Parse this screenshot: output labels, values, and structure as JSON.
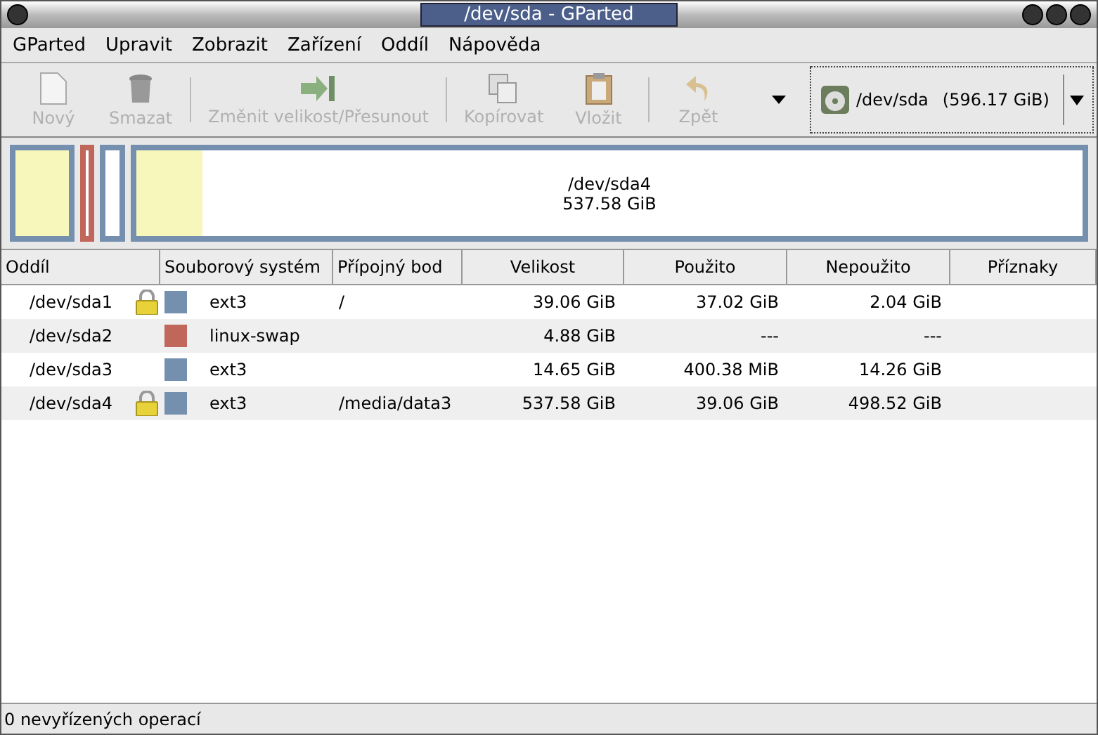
{
  "window": {
    "title": "/dev/sda - GParted"
  },
  "menu": [
    "GParted",
    "Upravit",
    "Zobrazit",
    "Zařízení",
    "Oddíl",
    "Nápověda"
  ],
  "toolbar": [
    {
      "kind": "new",
      "label": "Nový",
      "disabled": true
    },
    {
      "kind": "delete",
      "label": "Smazat",
      "disabled": true
    },
    {
      "kind": "separator"
    },
    {
      "kind": "resize",
      "label": "Změnit velikost/Přesunout",
      "disabled": true
    },
    {
      "kind": "separator"
    },
    {
      "kind": "copy",
      "label": "Kopírovat",
      "disabled": true
    },
    {
      "kind": "paste",
      "label": "Vložit",
      "disabled": true
    },
    {
      "kind": "separator"
    },
    {
      "kind": "undo",
      "label": "Zpět",
      "disabled": true
    }
  ],
  "device": {
    "name": "/dev/sda",
    "size": "(596.17 GiB)"
  },
  "map": [
    {
      "kind": "medium",
      "color": "#7590ae",
      "level": 1
    },
    {
      "kind": "tiny",
      "color": "#c1665a"
    },
    {
      "kind": "small",
      "color": "#7590ae"
    },
    {
      "kind": "large",
      "color": "#7590ae",
      "level": 0.07,
      "name": "/dev/sda4",
      "size": "537.58 GiB"
    }
  ],
  "table": {
    "columns": [
      "Oddíl",
      "Souborový systém",
      "Přípojný bod",
      "Velikost",
      "Použito",
      "Nepoužito",
      "Příznaky"
    ],
    "rows": [
      {
        "partition": "/dev/sda1",
        "locked": true,
        "color": "#7590ae",
        "fs": "ext3",
        "mount": "/",
        "size": "39.06 GiB",
        "used": "37.02 GiB",
        "unused": "2.04 GiB"
      },
      {
        "partition": "/dev/sda2",
        "locked": false,
        "color": "#c1665a",
        "fs": "linux-swap",
        "size": "4.88 GiB",
        "used": "---",
        "unused": "---"
      },
      {
        "partition": "/dev/sda3",
        "locked": false,
        "color": "#7590ae",
        "fs": "ext3",
        "size": "14.65 GiB",
        "used": "400.38 MiB",
        "unused": "14.26 GiB"
      },
      {
        "partition": "/dev/sda4",
        "locked": true,
        "color": "#7590ae",
        "fs": "ext3",
        "mount": "/media/data3",
        "size": "537.58 GiB",
        "used": "39.06 GiB",
        "unused": "498.52 GiB"
      }
    ]
  },
  "status_bar": "0 nevyřízených operací"
}
